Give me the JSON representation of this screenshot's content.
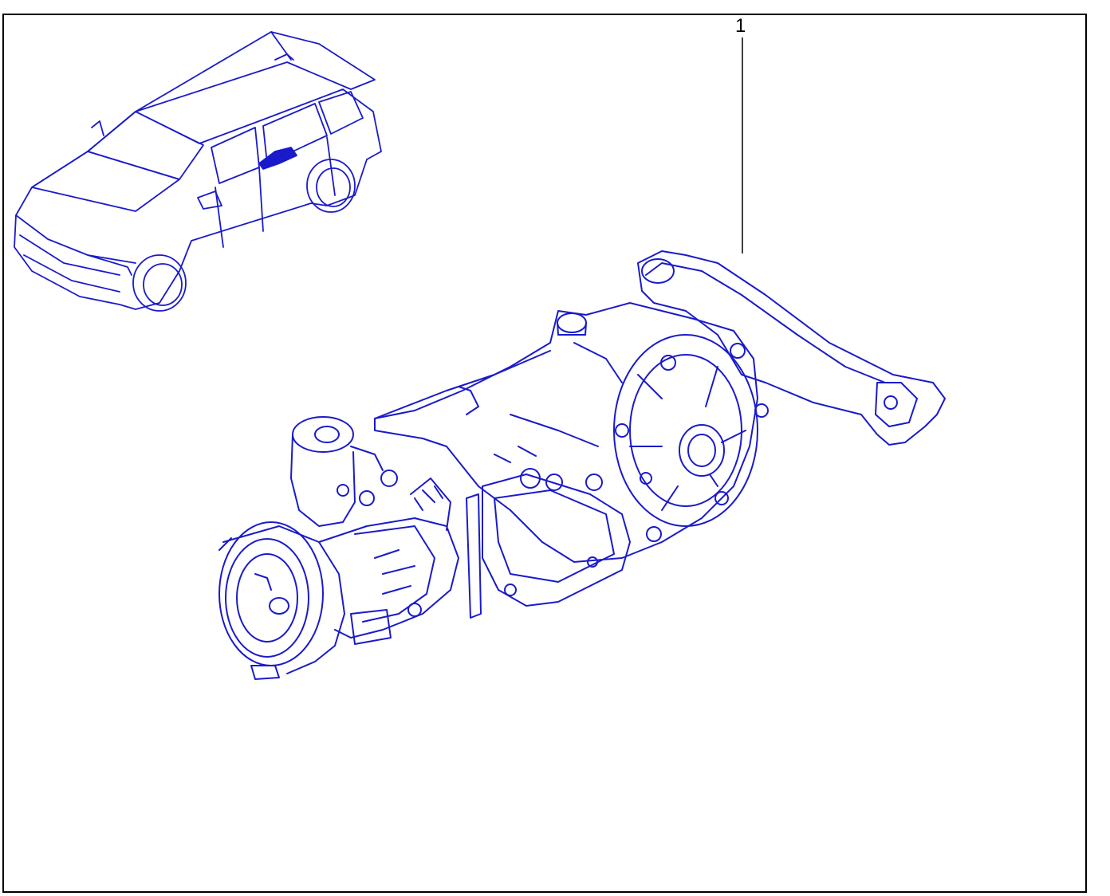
{
  "diagram": {
    "callouts": [
      {
        "number": "1"
      }
    ],
    "colors": {
      "line_art": "#1a1acb",
      "frame": "#000000",
      "background": "#ffffff"
    },
    "icons": {
      "vehicle": "suv-locator-icon",
      "part": "rear-axle-differential-subframe"
    }
  }
}
